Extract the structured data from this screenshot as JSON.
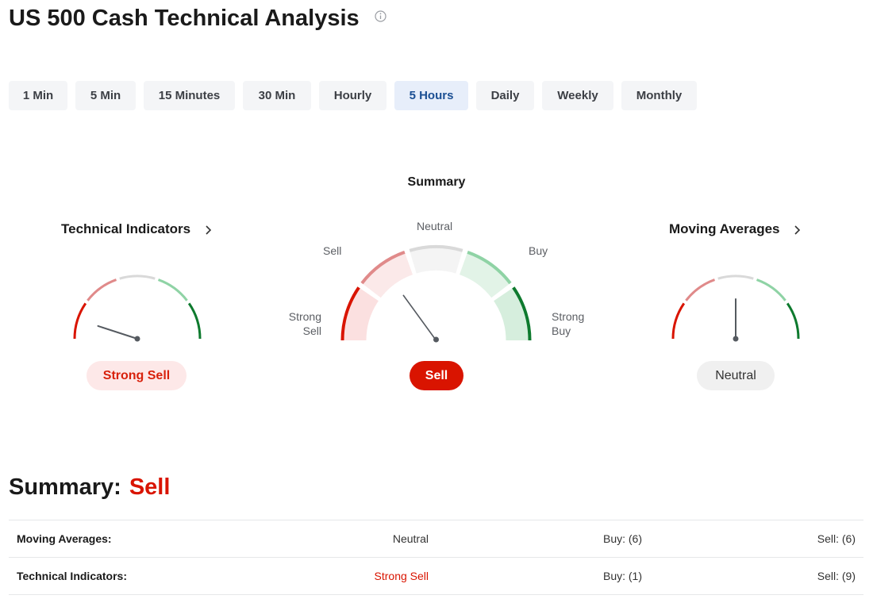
{
  "page": {
    "title": "US 500 Cash Technical Analysis"
  },
  "tabs": [
    "1 Min",
    "5 Min",
    "15 Minutes",
    "30 Min",
    "Hourly",
    "5 Hours",
    "Daily",
    "Weekly",
    "Monthly"
  ],
  "active_tab": "5 Hours",
  "summary": {
    "heading": "Summary",
    "labels": {
      "strong_sell": "Strong\nSell",
      "sell": "Sell",
      "neutral": "Neutral",
      "buy": "Buy",
      "strong_buy": "Strong\nBuy"
    },
    "value": "Sell"
  },
  "technical_indicators": {
    "title": "Technical Indicators",
    "value": "Strong Sell"
  },
  "moving_averages": {
    "title": "Moving Averages",
    "value": "Neutral"
  },
  "bottom": {
    "label": "Summary:",
    "value": "Sell",
    "rows": [
      {
        "name": "Moving Averages:",
        "status": "Neutral",
        "buy": "Buy: (6)",
        "sell": "Sell: (6)"
      },
      {
        "name": "Technical Indicators:",
        "status": "Strong Sell",
        "buy": "Buy: (1)",
        "sell": "Sell: (9)"
      }
    ]
  },
  "colors": {
    "strong_sell": "#d91400",
    "sell": "#e08a8a",
    "neutral": "#d9d9d9",
    "buy": "#8fd3a5",
    "strong_buy": "#0e7a2e",
    "active_tab_bg": "#e7eefa"
  },
  "icons": {
    "info": "info-circle-icon",
    "chevron": "chevron-right-icon"
  }
}
